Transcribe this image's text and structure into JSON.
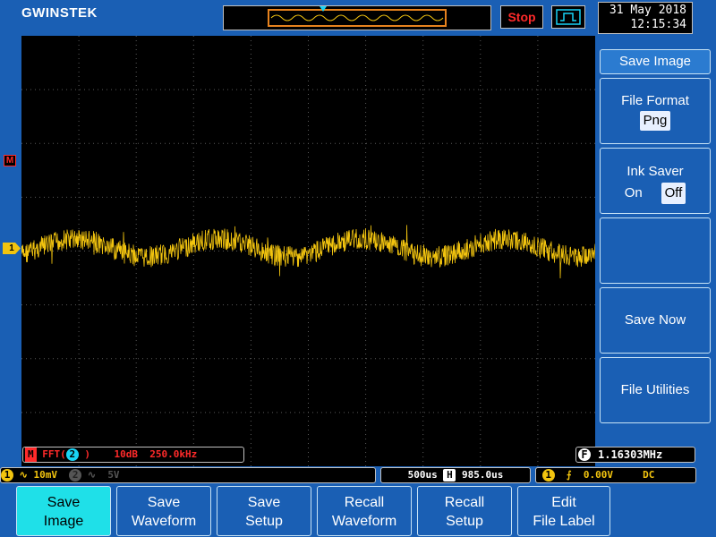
{
  "brand": {
    "logo_text": "GWINSTEK"
  },
  "top": {
    "stop_label": "Stop",
    "date": "31 May 2018",
    "time": "12:15:34"
  },
  "markers": {
    "math": "M",
    "ch1": "1"
  },
  "fft_info": {
    "badge": "M",
    "label": "FFT(",
    "source": "2",
    "close": ")",
    "scale": "10dB",
    "span": "250.0kHz"
  },
  "freq_info": {
    "badge": "F",
    "value": "1.16303MHz"
  },
  "channel_status": {
    "ch1_num": "1",
    "ch1_coupling": "∿",
    "ch1_scale": "10mV",
    "ch2_num": "2",
    "ch2_coupling": "∿",
    "ch2_scale": "5V"
  },
  "time_status": {
    "timebase": "500us",
    "h_badge": "H",
    "position": "985.0us"
  },
  "trigger_status": {
    "source": "1",
    "slope": "⨍",
    "level": "0.00V",
    "coupling": "DC"
  },
  "side_menu": {
    "title": "Save Image",
    "file_format_label": "File Format",
    "file_format_value": "Png",
    "ink_saver_label": "Ink Saver",
    "ink_on": "On",
    "ink_off": "Off",
    "save_now": "Save Now",
    "file_utilities": "File Utilities"
  },
  "bottom_menu": [
    {
      "line1": "Save",
      "line2": "Image"
    },
    {
      "line1": "Save",
      "line2": "Waveform"
    },
    {
      "line1": "Save",
      "line2": "Setup"
    },
    {
      "line1": "Recall",
      "line2": "Waveform"
    },
    {
      "line1": "Recall",
      "line2": "Setup"
    },
    {
      "line1": "Edit",
      "line2": "File Label"
    }
  ],
  "colors": {
    "background": "#1a5fb4",
    "trace_ch1": "#f2c40f",
    "math": "#ff2a2a",
    "ch2": "#19d3f5",
    "grid": "#5a5a5a",
    "active_button": "#1fe0e8"
  }
}
